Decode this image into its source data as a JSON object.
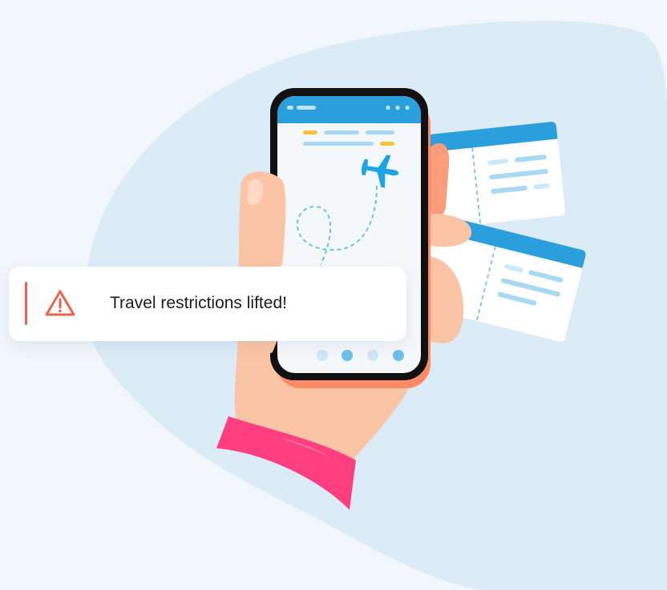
{
  "notification": {
    "message": "Travel restrictions lifted!",
    "accent_color": "#e8644b",
    "icon": "warning-triangle-icon"
  },
  "colors": {
    "background": "#f1f7fc",
    "blob": "#dcecf7",
    "phone_frame": "#111111",
    "phone_header": "#2a9fdb",
    "plane": "#1ea4e4",
    "skin": "#fbc4a4",
    "sleeve": "#ff3f7f",
    "ticket_header": "#2a9fdb"
  }
}
